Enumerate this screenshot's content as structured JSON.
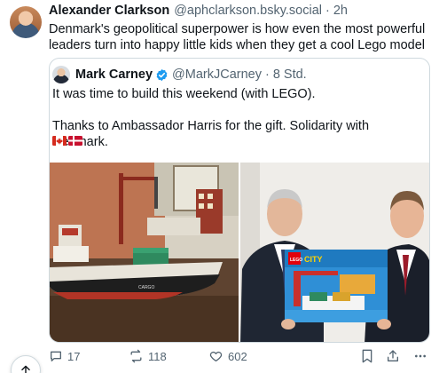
{
  "post": {
    "author_name": "Alexander Clarkson",
    "author_handle": "@aphclarkson.bsky.social",
    "separator": "·",
    "time": "2h",
    "text": "Denmark's geopolitical superpower is how even the most powerful leaders turn into happy little kids when they get a cool Lego model"
  },
  "quote": {
    "author_name": "Mark Carney",
    "author_handle": "@MarkJCarney",
    "separator": "·",
    "time": "8 Std.",
    "line1": "It was time to build this weekend (with LEGO).",
    "line2": "Thanks to Ambassador Harris for the gift. Solidarity with Denmark.",
    "flags": [
      "canada-flag",
      "denmark-flag"
    ],
    "media_left": {
      "hull_label": "CARGO"
    },
    "media_right": {
      "box_brand": "LEGO",
      "box_title": "CITY"
    }
  },
  "actions": {
    "replies": "17",
    "reposts": "118",
    "likes": "602"
  },
  "colors": {
    "text": "#0f1419",
    "muted": "#536471",
    "border": "#cfd9de",
    "verified": "#1d9bf0"
  }
}
